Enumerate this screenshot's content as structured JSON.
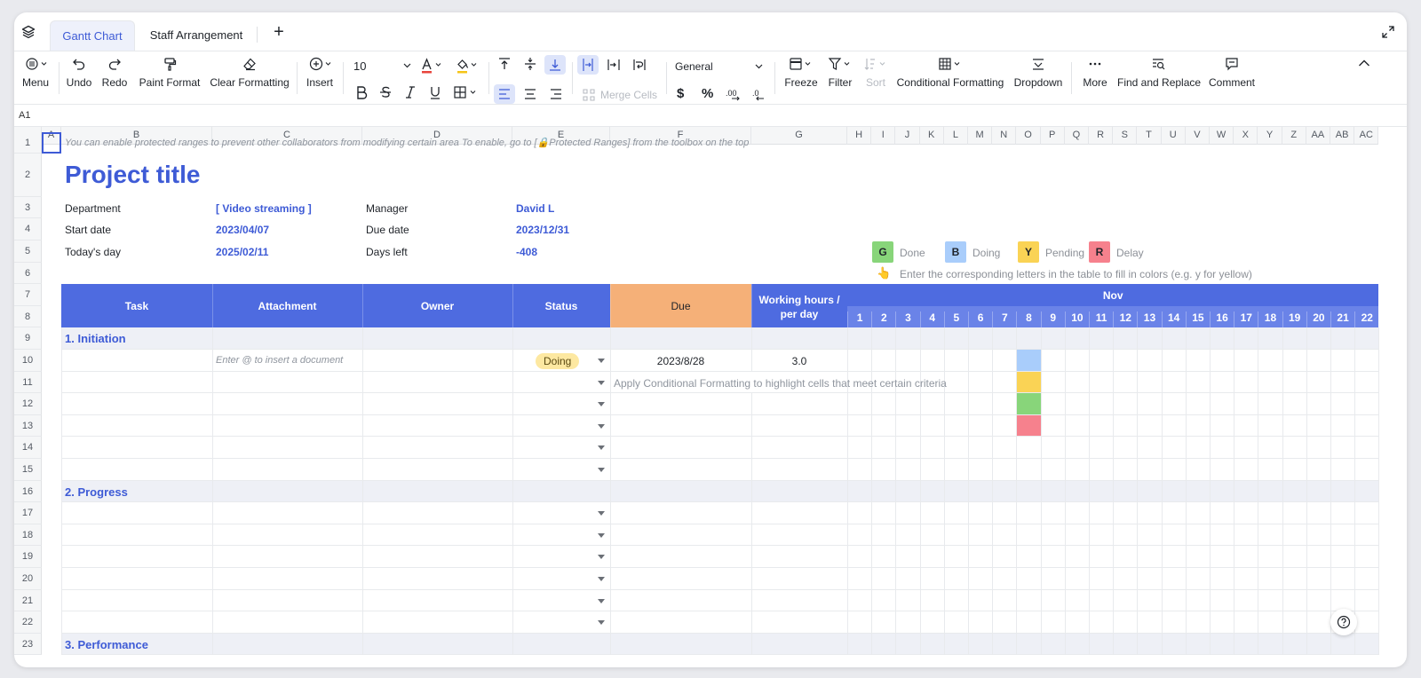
{
  "tabs": {
    "active": "Gantt Chart",
    "second": "Staff Arrangement",
    "add": "+"
  },
  "toolbar": {
    "menu": "Menu",
    "undo": "Undo",
    "redo": "Redo",
    "paint_format": "Paint Format",
    "clear_formatting": "Clear Formatting",
    "insert": "Insert",
    "font_size": "10",
    "merge_cells": "Merge Cells",
    "number_format": "General",
    "freeze": "Freeze",
    "filter": "Filter",
    "sort": "Sort",
    "conditional_formatting": "Conditional Formatting",
    "dropdown": "Dropdown",
    "more": "More",
    "find_replace": "Find and Replace",
    "comment": "Comment",
    "dollar": "$",
    "percent": "%"
  },
  "cell_ref": "A1",
  "columns": [
    "A",
    "B",
    "C",
    "D",
    "E",
    "F",
    "G",
    "H",
    "I",
    "J",
    "K",
    "L",
    "M",
    "N",
    "O",
    "P",
    "Q",
    "R",
    "S",
    "T",
    "U",
    "V",
    "W",
    "X",
    "Y",
    "Z",
    "AA",
    "AB",
    "AC"
  ],
  "rows": [
    "1",
    "2",
    "3",
    "4",
    "5",
    "6",
    "7",
    "8",
    "9",
    "10",
    "11",
    "12",
    "13",
    "14",
    "15",
    "16",
    "17",
    "18",
    "19",
    "20",
    "21",
    "22",
    "23"
  ],
  "sheet": {
    "hint": "You can enable protected ranges to prevent other collaborators from modifying certain area To enable, go to [🔒Protected Ranges] from the toolbox on the top",
    "title": "Project title",
    "department_label": "Department",
    "department_value": "[ Video streaming ]",
    "manager_label": "Manager",
    "manager_value": "David L",
    "start_label": "Start date",
    "start_value": "2023/04/07",
    "due_label": "Due date",
    "due_value": "2023/12/31",
    "today_label": "Today's day",
    "today_value": "2025/02/11",
    "days_left_label": "Days left",
    "days_left_value": "-408"
  },
  "legend": {
    "items": [
      {
        "letter": "G",
        "label": "Done",
        "color": "#88d57a"
      },
      {
        "letter": "B",
        "label": "Doing",
        "color": "#a9cdfb"
      },
      {
        "letter": "Y",
        "label": "Pending",
        "color": "#fad355"
      },
      {
        "letter": "R",
        "label": "Delay",
        "color": "#f6818d"
      }
    ],
    "hint_icon": "👆",
    "hint": "Enter the corresponding letters in the table to fill in colors (e.g. y for yellow)"
  },
  "table_header": {
    "task": "Task",
    "attachment": "Attachment",
    "owner": "Owner",
    "status": "Status",
    "due": "Due",
    "working_hours_1": "Working hours /",
    "working_hours_2": "per day",
    "month": "Nov",
    "days": [
      "1",
      "2",
      "3",
      "4",
      "5",
      "6",
      "7",
      "8",
      "9",
      "10",
      "11",
      "12",
      "13",
      "14",
      "15",
      "16",
      "17",
      "18",
      "19",
      "20",
      "21",
      "22"
    ]
  },
  "sections": {
    "s1": "1. Initiation",
    "s2": "2. Progress",
    "s3": "3. Performance"
  },
  "row10": {
    "attachment_placeholder": "Enter @ to insert a document",
    "status": "Doing",
    "due": "2023/8/28",
    "hours": "3.0"
  },
  "row11": {
    "cf_hint": "Apply Conditional Formatting to highlight cells that meet certain criteria"
  },
  "gantt_fills": [
    {
      "row": "10",
      "day": "8",
      "color": "#a9cdfb"
    },
    {
      "row": "11",
      "day": "8",
      "color": "#fad355"
    },
    {
      "row": "12",
      "day": "8",
      "color": "#88d57a"
    },
    {
      "row": "13",
      "day": "8",
      "color": "#f6818d"
    }
  ],
  "colors": {
    "accent": "#3e5bd6",
    "header_blue": "#4e6be0",
    "due_orange": "#f5b078",
    "section_bg": "#eef0f6",
    "status_pill": "#fde8a1"
  }
}
